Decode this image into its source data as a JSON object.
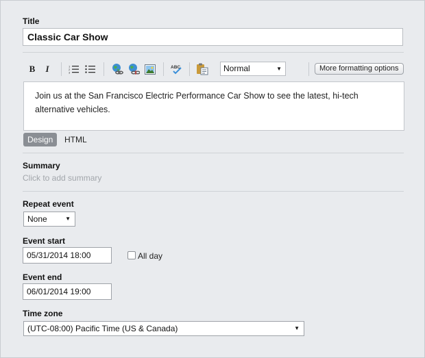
{
  "title_field": {
    "label": "Title",
    "value": "Classic Car Show"
  },
  "toolbar": {
    "bold_label": "B",
    "italic_label": "I",
    "format_select": {
      "value": "Normal"
    },
    "more_formatting_label": "More formatting options",
    "icons": [
      "bold-icon",
      "italic-icon",
      "ordered-list-icon",
      "unordered-list-icon",
      "insert-link-icon",
      "remove-link-icon",
      "insert-image-icon",
      "spellcheck-icon",
      "paste-icon"
    ]
  },
  "editor": {
    "content": "Join us at the San Francisco Electric Performance Car Show to see the latest, hi-tech alternative vehicles."
  },
  "mode_tabs": {
    "design": "Design",
    "html": "HTML"
  },
  "summary": {
    "label": "Summary",
    "placeholder": "Click to add summary"
  },
  "repeat_event": {
    "label": "Repeat event",
    "value": "None"
  },
  "event_start": {
    "label": "Event start",
    "value": "05/31/2014 18:00"
  },
  "all_day": {
    "label": "All day",
    "checked": false
  },
  "event_end": {
    "label": "Event end",
    "value": "06/01/2014 19:00"
  },
  "time_zone": {
    "label": "Time zone",
    "value": "(UTC-08:00) Pacific Time (US & Canada)"
  },
  "colors": {
    "background": "#e9ebee",
    "border": "#b9bcc1",
    "active_tab": "#8a8e94",
    "placeholder": "#a2a6ab"
  }
}
